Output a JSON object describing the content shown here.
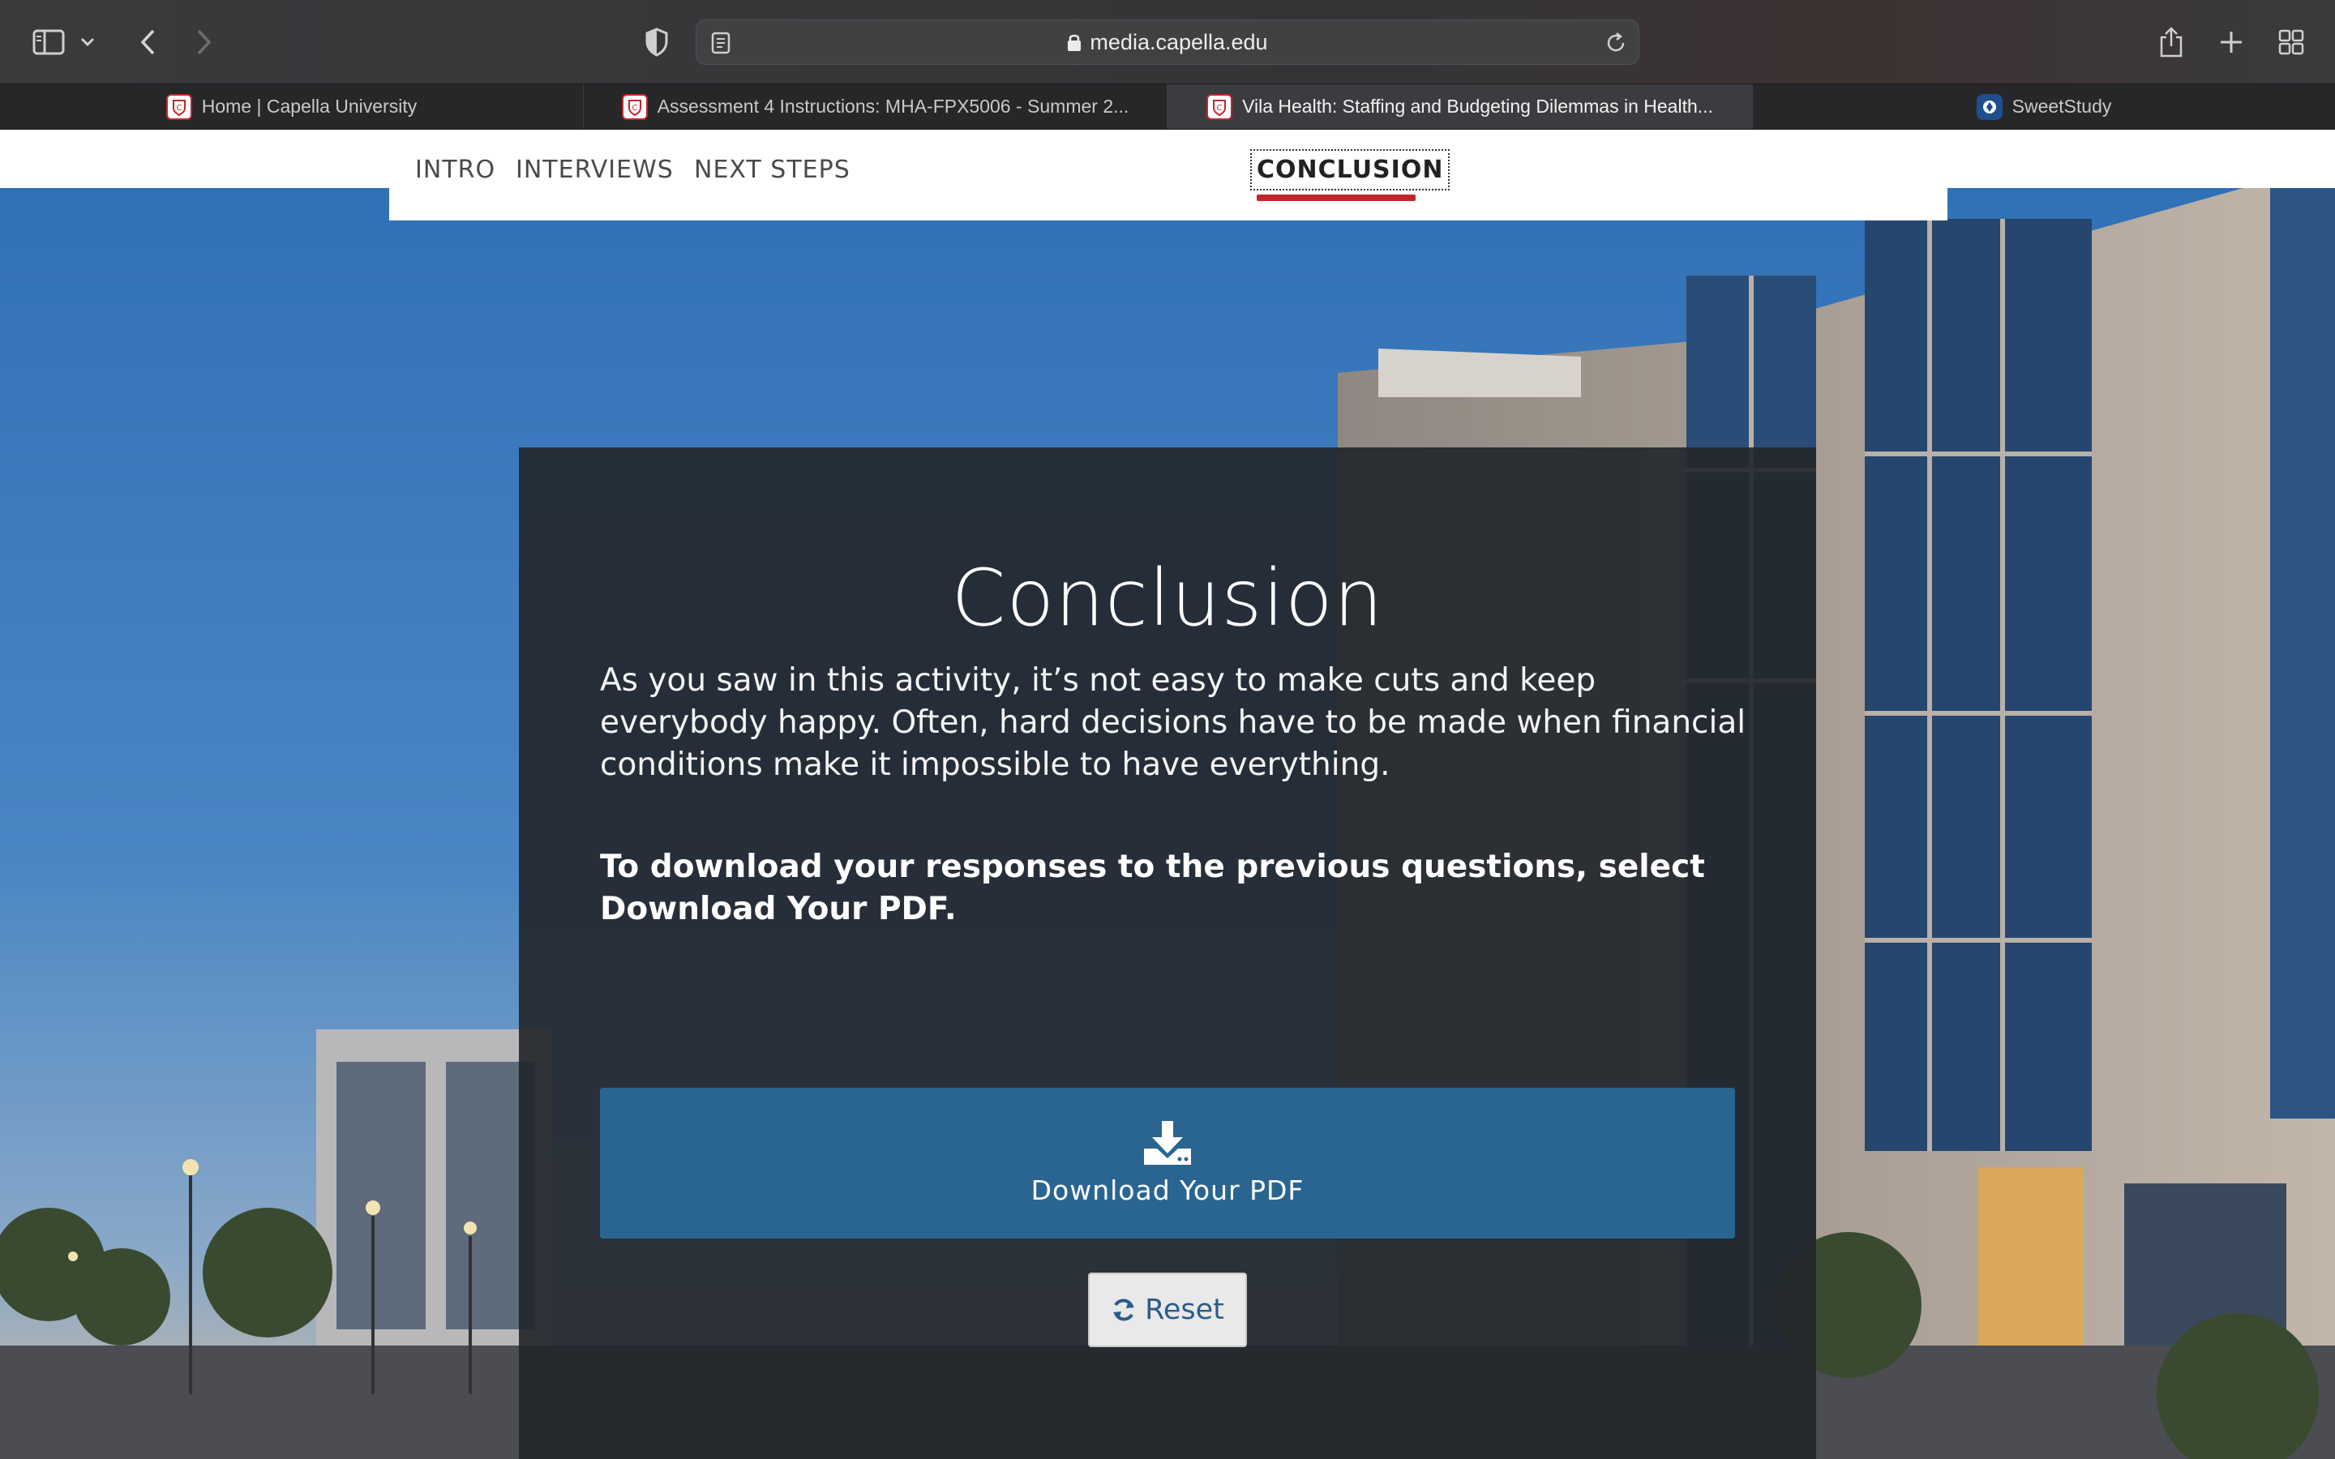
{
  "browser": {
    "url": "media.capella.edu",
    "tabs": [
      {
        "title": "Home | Capella University",
        "icon": "capella-icon",
        "active": false
      },
      {
        "title": "Assessment 4 Instructions: MHA-FPX5006 - Summer 2...",
        "icon": "capella-icon",
        "active": false
      },
      {
        "title": "Vila Health: Staffing and Budgeting Dilemmas in Health...",
        "icon": "capella-icon",
        "active": true
      },
      {
        "title": "SweetStudy",
        "icon": "sweetstudy-icon",
        "active": false
      }
    ]
  },
  "nav": {
    "items": [
      "INTRO",
      "INTERVIEWS",
      "NEXT STEPS",
      "CONCLUSION"
    ],
    "current": "CONCLUSION",
    "accent": "#c0272d"
  },
  "conclusion": {
    "title": "Conclusion",
    "body": "As you saw in this activity, it’s not easy to make cuts and keep everybody happy. Often, hard decisions have to be made when financial conditions make it impossible to have everything.",
    "instruction": "To download your responses to the previous questions, select Download Your PDF.",
    "download_label": "Download Your PDF",
    "reset_label": "Reset",
    "button_color": "#2a6592"
  }
}
